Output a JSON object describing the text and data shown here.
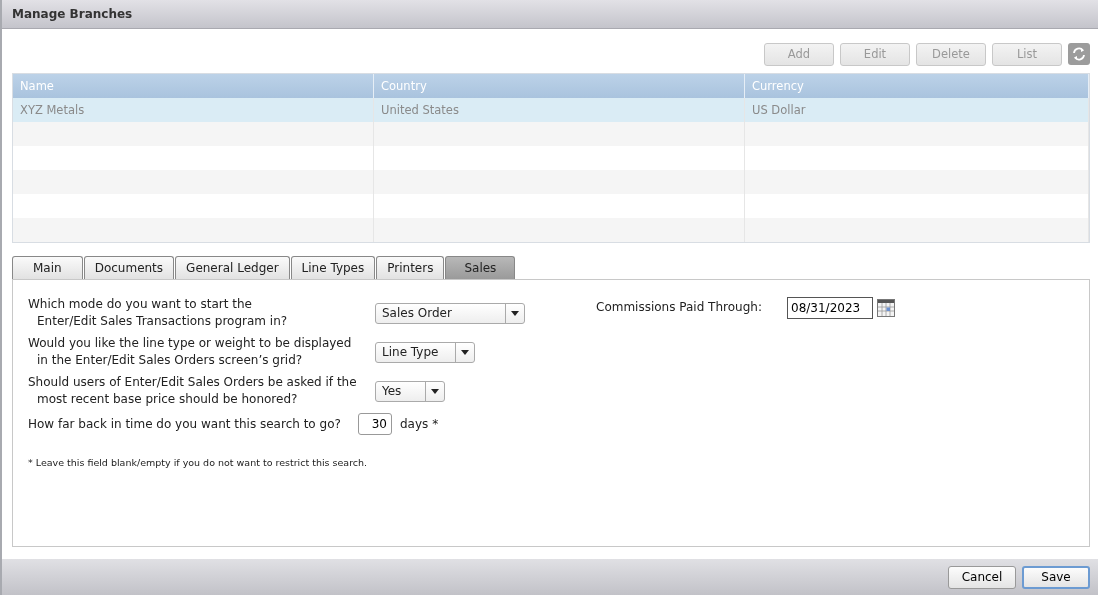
{
  "window": {
    "title": "Manage Branches"
  },
  "toolbar": {
    "buttons": [
      {
        "label": "Add",
        "disabled": true
      },
      {
        "label": "Edit",
        "disabled": true
      },
      {
        "label": "Delete",
        "disabled": true
      },
      {
        "label": "List",
        "disabled": true
      }
    ]
  },
  "table": {
    "columns": [
      "Name",
      "Country",
      "Currency"
    ],
    "rows": [
      {
        "cells": [
          "XYZ Metals",
          "United States",
          "US Dollar"
        ],
        "selected": true
      }
    ]
  },
  "tabs": [
    {
      "label": "Main",
      "selected": false
    },
    {
      "label": "Documents",
      "selected": false
    },
    {
      "label": "General Ledger",
      "selected": false
    },
    {
      "label": "Line Types",
      "selected": false
    },
    {
      "label": "Printers",
      "selected": false
    },
    {
      "label": "Sales",
      "selected": true
    }
  ],
  "questions": [
    {
      "kind": "select",
      "lines": [
        "Which mode do you want to start the",
        "Enter/Edit Sales Transactions program in?"
      ],
      "value": "Sales Order"
    },
    {
      "kind": "select",
      "lines": [
        "Would you like the line type or weight to be displayed",
        "in the Enter/Edit Sales Orders screen’s grid?"
      ],
      "value": "Line Type"
    },
    {
      "kind": "select",
      "lines": [
        "Should users of Enter/Edit Sales Orders be asked if the",
        "most recent base price should be honored?"
      ],
      "value": "Yes"
    },
    {
      "kind": "number",
      "lines": [
        "How far back in time do you want this search to go?"
      ],
      "value": "30",
      "unit": "days *"
    }
  ],
  "footnote": "* Leave this field blank/empty if you do not want to restrict this search.",
  "commissions": {
    "label": "Commissions Paid Through:",
    "value": "08/31/2023"
  },
  "footer": {
    "buttons": [
      {
        "label": "Cancel",
        "focused": false
      },
      {
        "label": "Save",
        "focused": true
      }
    ]
  }
}
